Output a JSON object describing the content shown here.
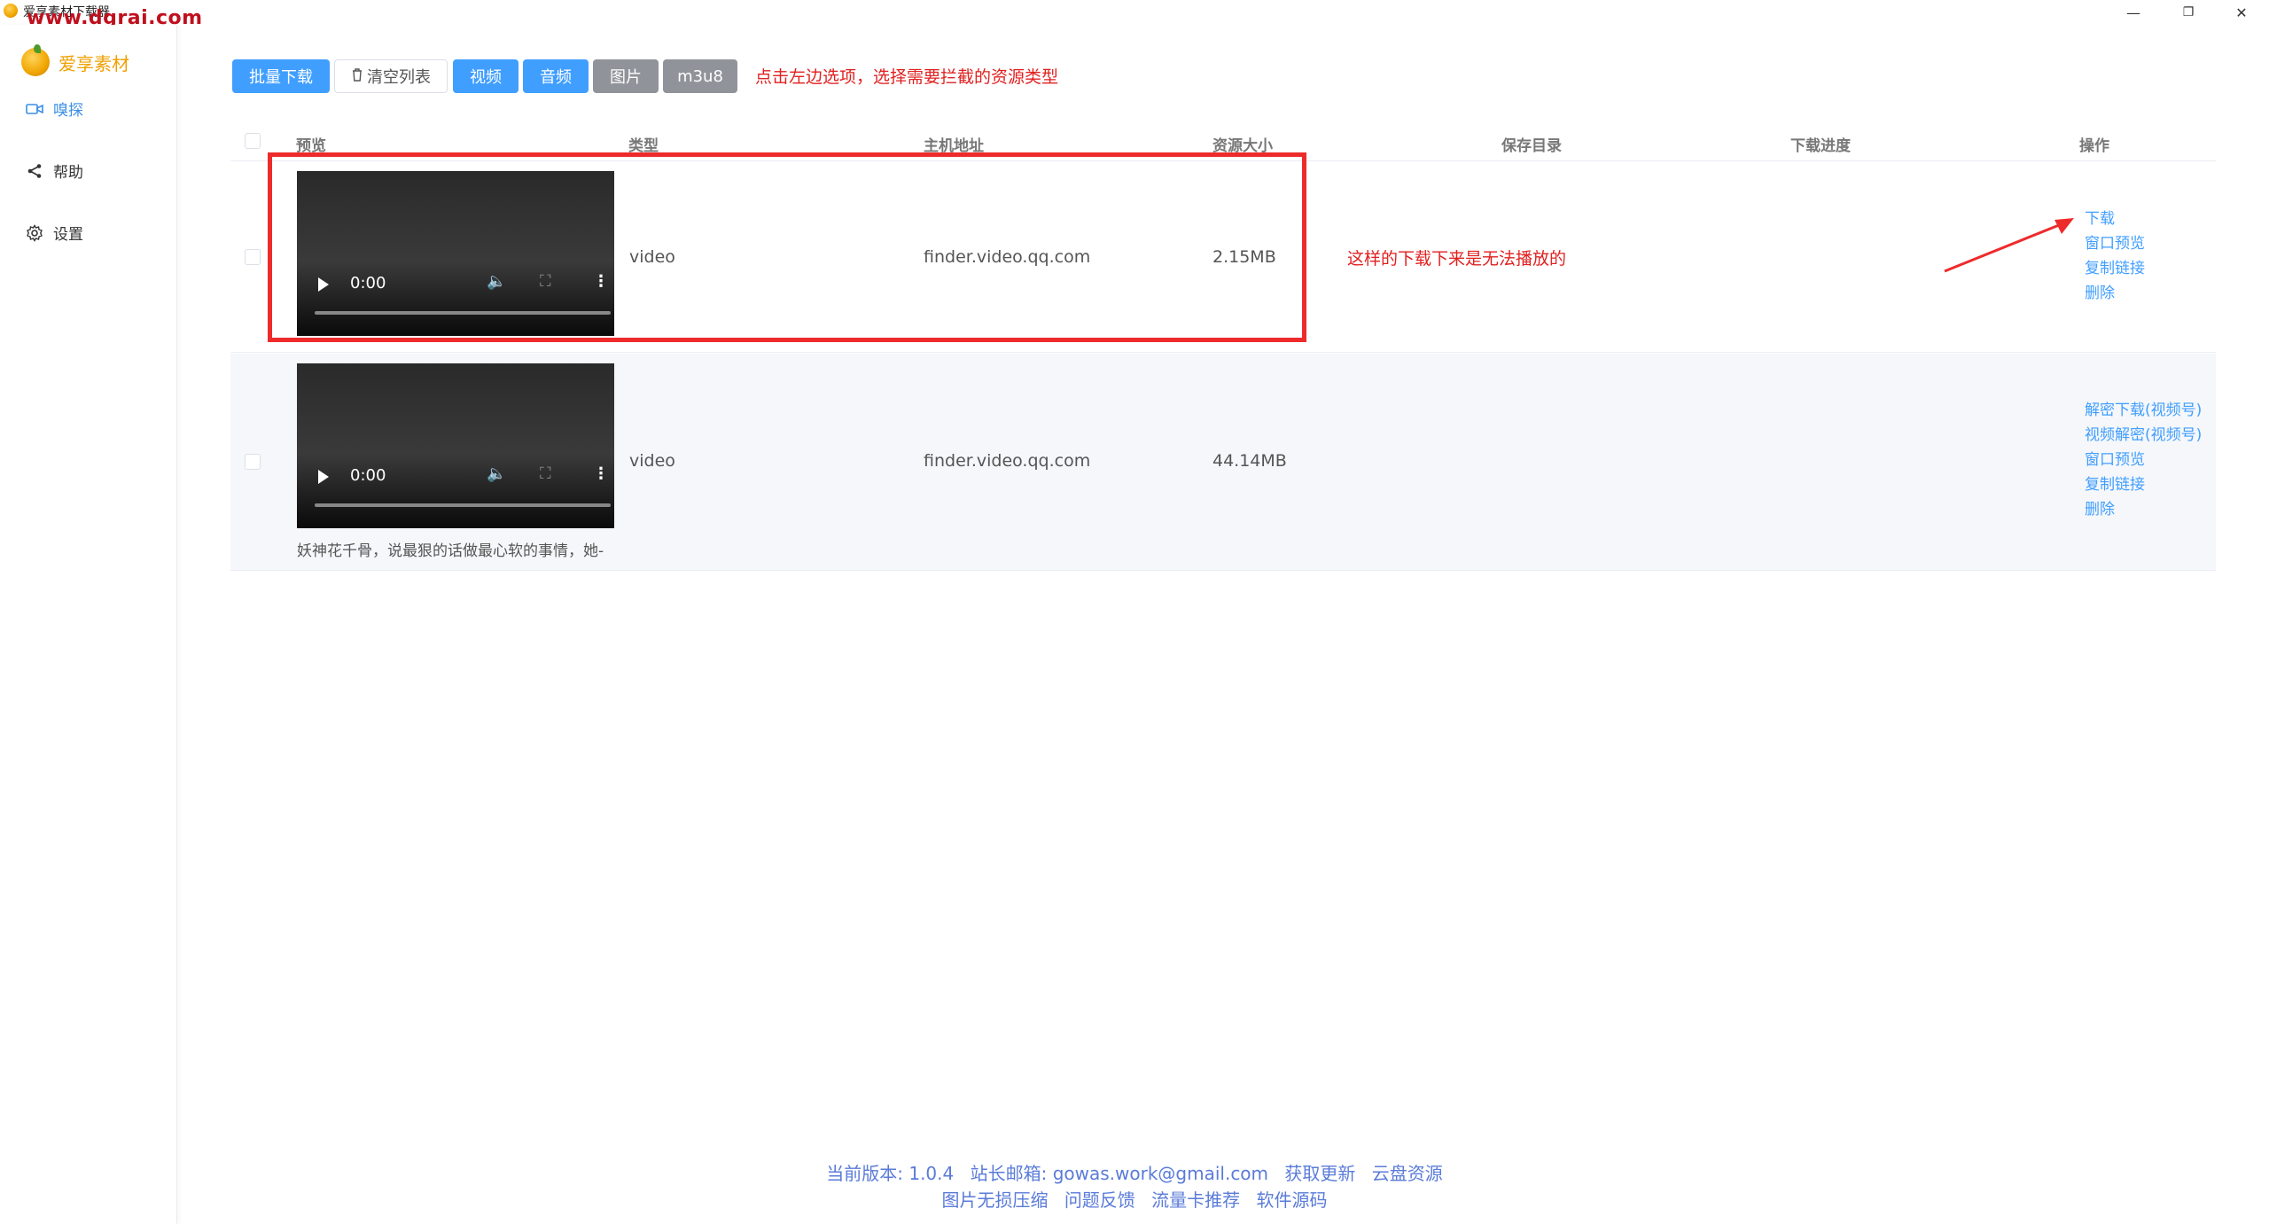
{
  "window": {
    "title": "爱享素材下载器",
    "watermark": "www.dgrai.com",
    "minimize": "—",
    "restore": "❐",
    "close": "✕"
  },
  "sidebar": {
    "brand": "爱享素材",
    "items": [
      {
        "label": "嗅探",
        "icon": "video-camera-icon",
        "active": true
      },
      {
        "label": "帮助",
        "icon": "share-icon",
        "active": false
      },
      {
        "label": "设置",
        "icon": "gear-icon",
        "active": false
      }
    ]
  },
  "toolbar": {
    "batch_download": "批量下载",
    "clear_list": "清空列表",
    "video": "视频",
    "audio": "音频",
    "image": "图片",
    "m3u8": "m3u8",
    "hint": "点击左边选项，选择需要拦截的资源类型"
  },
  "table": {
    "headers": {
      "preview": "预览",
      "type": "类型",
      "host": "主机地址",
      "size": "资源大小",
      "save_dir": "保存目录",
      "progress": "下载进度",
      "actions": "操作"
    },
    "rows": [
      {
        "type": "video",
        "host": "finder.video.qq.com",
        "size": "2.15MB",
        "time": "0:00",
        "caption": "",
        "actions": [
          "下载",
          "窗口预览",
          "复制链接",
          "删除"
        ]
      },
      {
        "type": "video",
        "host": "finder.video.qq.com",
        "size": "44.14MB",
        "time": "0:00",
        "caption": "妖神花千骨，说最狠的话做最心软的事情，她-",
        "actions": [
          "解密下载(视频号)",
          "视频解密(视频号)",
          "窗口预览",
          "复制链接",
          "删除"
        ]
      }
    ]
  },
  "annotation": {
    "text": "这样的下载下来是无法播放的",
    "color": "#ee2b2b"
  },
  "footer": {
    "line1": [
      "当前版本: 1.0.4",
      "站长邮箱: gowas.work@gmail.com",
      "获取更新",
      "云盘资源"
    ],
    "line2": [
      "图片无损压缩",
      "问题反馈",
      "流量卡推荐",
      "软件源码"
    ]
  },
  "colors": {
    "primary": "#409eff",
    "gray_button": "#909399",
    "link": "#409eff",
    "brand": "#f0a000",
    "hint_red": "#e02020",
    "footer_link": "#5a7bd8"
  }
}
